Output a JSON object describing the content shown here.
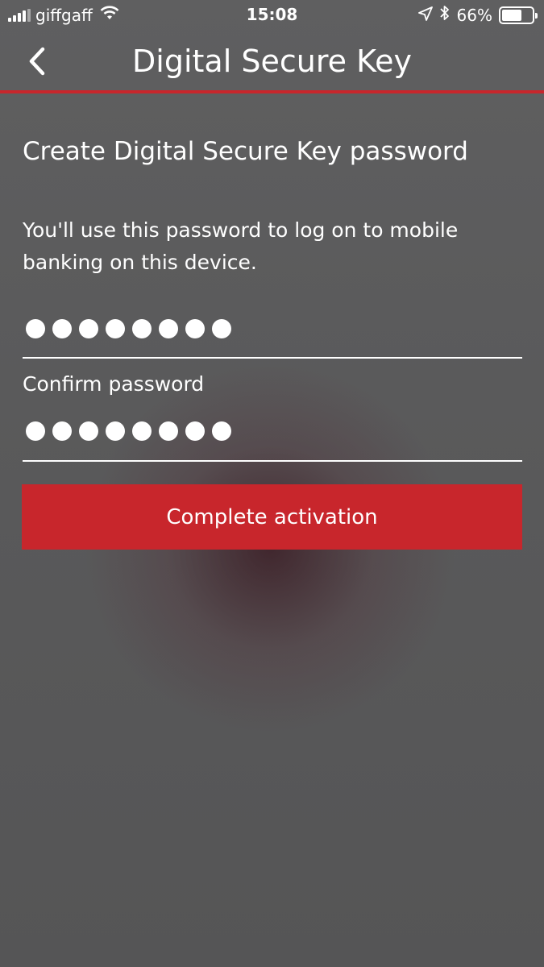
{
  "status_bar": {
    "carrier": "giffgaff",
    "time": "15:08",
    "battery": "66%",
    "battery_level": 0.66,
    "icons": [
      "signal-icon",
      "wifi-icon",
      "location-icon",
      "bluetooth-icon",
      "battery-icon"
    ]
  },
  "nav": {
    "title": "Digital Secure Key",
    "back_icon": "chevron-left-icon"
  },
  "form": {
    "heading": "Create Digital Secure Key password",
    "description": "You'll use this password to log on to mobile banking on this device.",
    "password_mask": "••••••••",
    "confirm_label": "Confirm password",
    "confirm_mask": "••••••••"
  },
  "actions": {
    "complete_label": "Complete activation"
  },
  "colors": {
    "accent": "#c8262c",
    "background": "#555556",
    "text": "#ffffff"
  }
}
